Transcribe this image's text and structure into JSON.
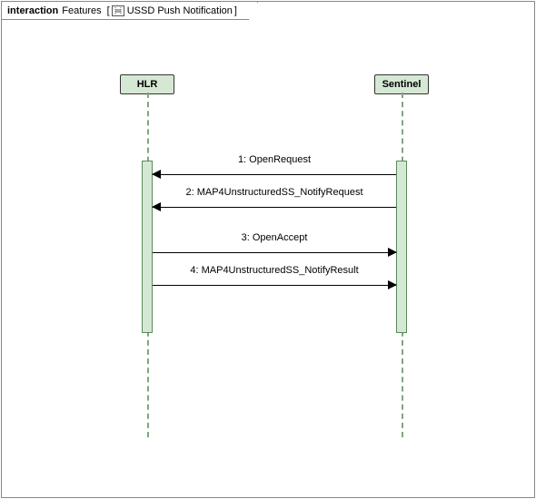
{
  "frame": {
    "keyword": "interaction",
    "label": "Features",
    "bracket_open": "[",
    "bracket_close": "]",
    "title": "USSD Push Notification"
  },
  "participants": {
    "left": "HLR",
    "right": "Sentinel"
  },
  "messages": [
    {
      "label": "1: OpenRequest",
      "dir": "left"
    },
    {
      "label": "2: MAP4UnstructuredSS_NotifyRequest",
      "dir": "left"
    },
    {
      "label": "3: OpenAccept",
      "dir": "right"
    },
    {
      "label": "4: MAP4UnstructuredSS_NotifyResult",
      "dir": "right"
    }
  ],
  "chart_data": {
    "type": "table",
    "diagram": "UML sequence diagram",
    "title": "interaction Features [ USSD Push Notification ]",
    "participants": [
      "HLR",
      "Sentinel"
    ],
    "messages": [
      {
        "seq": 1,
        "from": "Sentinel",
        "to": "HLR",
        "name": "OpenRequest"
      },
      {
        "seq": 2,
        "from": "Sentinel",
        "to": "HLR",
        "name": "MAP4UnstructuredSS_NotifyRequest"
      },
      {
        "seq": 3,
        "from": "HLR",
        "to": "Sentinel",
        "name": "OpenAccept"
      },
      {
        "seq": 4,
        "from": "HLR",
        "to": "Sentinel",
        "name": "MAP4UnstructuredSS_NotifyResult"
      }
    ]
  }
}
